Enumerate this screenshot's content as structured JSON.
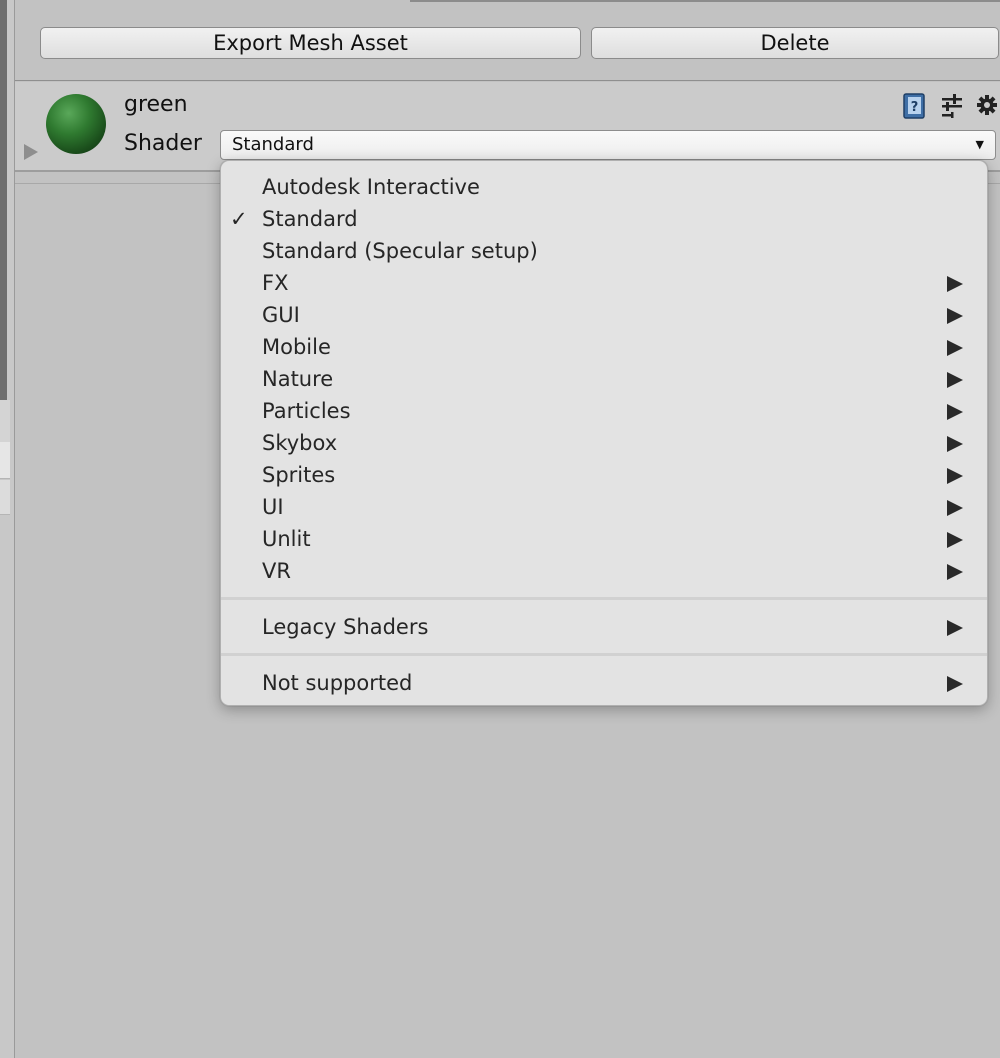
{
  "toolbar": {
    "export_label": "Export Mesh Asset",
    "delete_label": "Delete"
  },
  "material": {
    "name": "green",
    "shader_label": "Shader",
    "shader_value": "Standard",
    "caret": "▼",
    "preview_color": "#2f7a30",
    "header_icons": [
      "help-book-icon",
      "presets-sliders-icon",
      "gear-icon"
    ]
  },
  "shader_menu": {
    "checkmark": "✓",
    "items": [
      {
        "label": "Autodesk Interactive",
        "checked": false,
        "submenu": false
      },
      {
        "label": "Standard",
        "checked": true,
        "submenu": false
      },
      {
        "label": "Standard (Specular setup)",
        "checked": false,
        "submenu": false
      },
      {
        "label": "FX",
        "checked": false,
        "submenu": true
      },
      {
        "label": "GUI",
        "checked": false,
        "submenu": true
      },
      {
        "label": "Mobile",
        "checked": false,
        "submenu": true
      },
      {
        "label": "Nature",
        "checked": false,
        "submenu": true
      },
      {
        "label": "Particles",
        "checked": false,
        "submenu": true
      },
      {
        "label": "Skybox",
        "checked": false,
        "submenu": true
      },
      {
        "label": "Sprites",
        "checked": false,
        "submenu": true
      },
      {
        "label": "UI",
        "checked": false,
        "submenu": true
      },
      {
        "label": "Unlit",
        "checked": false,
        "submenu": true
      },
      {
        "label": "VR",
        "checked": false,
        "submenu": true
      }
    ],
    "legacy": {
      "label": "Legacy Shaders",
      "submenu": true
    },
    "unsupported": {
      "label": "Not supported",
      "submenu": true
    }
  }
}
